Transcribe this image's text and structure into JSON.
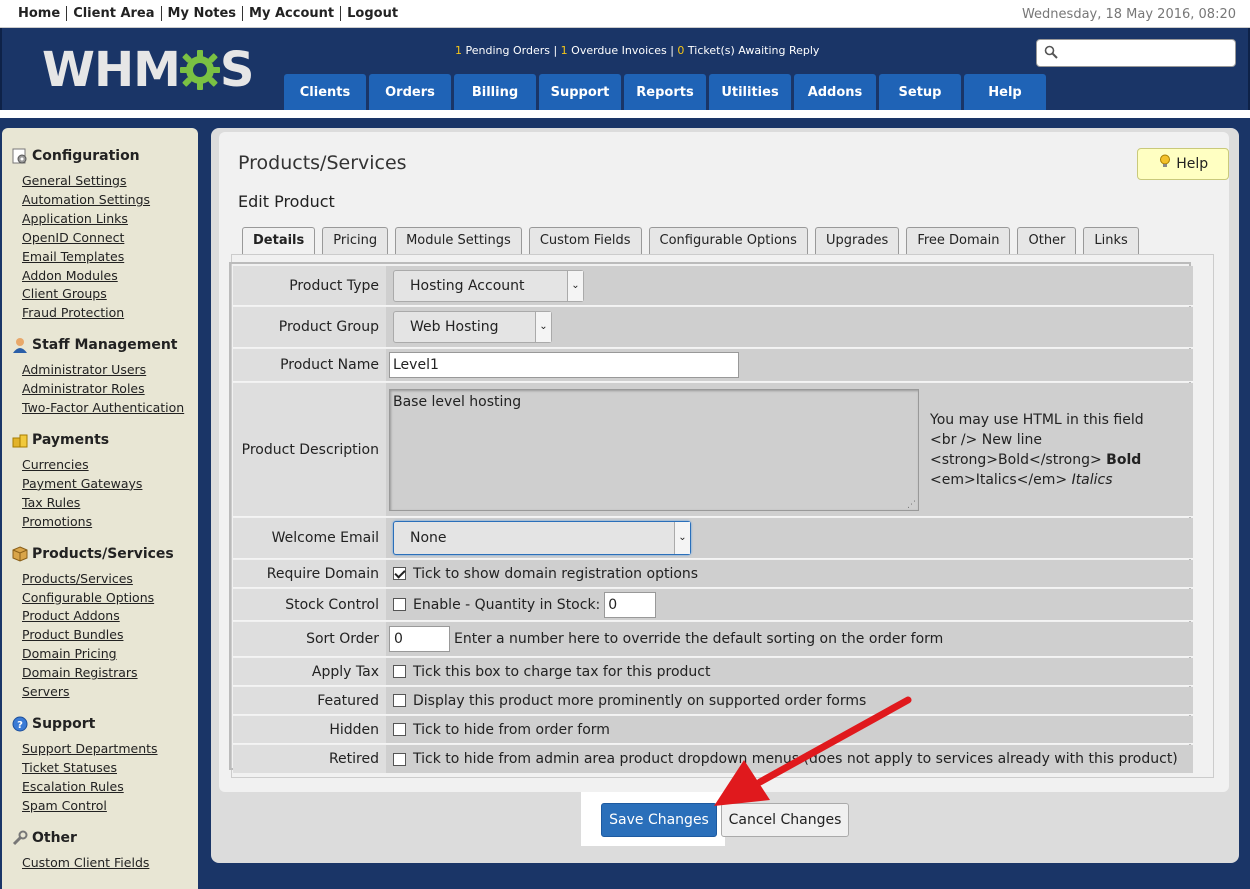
{
  "topbar": {
    "links": [
      "Home",
      "Client Area",
      "My Notes",
      "My Account",
      "Logout"
    ],
    "datetime": "Wednesday, 18 May 2016, 08:20"
  },
  "header": {
    "logo_text": "WHMCS",
    "notice": {
      "pending_orders_count": "1",
      "pending_orders_label": "Pending Orders",
      "overdue_invoices_count": "1",
      "overdue_invoices_label": "Overdue Invoices",
      "tickets_count": "0",
      "tickets_label": "Ticket(s) Awaiting Reply"
    },
    "search_placeholder": "",
    "nav": [
      "Clients",
      "Orders",
      "Billing",
      "Support",
      "Reports",
      "Utilities",
      "Addons",
      "Setup",
      "Help"
    ]
  },
  "sidebar": {
    "sections": [
      {
        "title": "Configuration",
        "icon": "gear-icon",
        "links": [
          "General Settings",
          "Automation Settings",
          "Application Links",
          "OpenID Connect",
          "Email Templates",
          "Addon Modules",
          "Client Groups",
          "Fraud Protection"
        ]
      },
      {
        "title": "Staff Management",
        "icon": "user-icon",
        "links": [
          "Administrator Users",
          "Administrator Roles",
          "Two-Factor Authentication"
        ]
      },
      {
        "title": "Payments",
        "icon": "coins-icon",
        "links": [
          "Currencies",
          "Payment Gateways",
          "Tax Rules",
          "Promotions"
        ]
      },
      {
        "title": "Products/Services",
        "icon": "box-icon",
        "links": [
          "Products/Services",
          "Configurable Options",
          "Product Addons",
          "Product Bundles",
          "Domain Pricing",
          "Domain Registrars",
          "Servers"
        ]
      },
      {
        "title": "Support",
        "icon": "help-circle-icon",
        "links": [
          "Support Departments",
          "Ticket Statuses",
          "Escalation Rules",
          "Spam Control"
        ]
      },
      {
        "title": "Other",
        "icon": "wrench-icon",
        "links": [
          "Custom Client Fields"
        ]
      }
    ]
  },
  "page": {
    "title": "Products/Services",
    "subtitle": "Edit Product",
    "help_label": "Help",
    "tabs": [
      "Details",
      "Pricing",
      "Module Settings",
      "Custom Fields",
      "Configurable Options",
      "Upgrades",
      "Free Domain",
      "Other",
      "Links"
    ],
    "active_tab": "Details"
  },
  "form": {
    "product_type": {
      "label": "Product Type",
      "value": "Hosting Account"
    },
    "product_group": {
      "label": "Product Group",
      "value": "Web Hosting"
    },
    "product_name": {
      "label": "Product Name",
      "value": "Level1"
    },
    "product_description": {
      "label": "Product Description",
      "value": "Base level hosting",
      "hint_1": "You may use HTML in this field",
      "hint_2": "<br /> New line",
      "hint_3a": "<strong>Bold</strong> ",
      "hint_3b": "Bold",
      "hint_4a": "<em>Italics</em> ",
      "hint_4b": "Italics"
    },
    "welcome_email": {
      "label": "Welcome Email",
      "value": "None"
    },
    "require_domain": {
      "label": "Require Domain",
      "text": "Tick to show domain registration options",
      "checked": true
    },
    "stock_control": {
      "label": "Stock Control",
      "text": "Enable - Quantity in Stock:",
      "checked": false,
      "quantity": "0"
    },
    "sort_order": {
      "label": "Sort Order",
      "value": "0",
      "text": "Enter a number here to override the default sorting on the order form"
    },
    "apply_tax": {
      "label": "Apply Tax",
      "text": "Tick this box to charge tax for this product",
      "checked": false
    },
    "featured": {
      "label": "Featured",
      "text": "Display this product more prominently on supported order forms",
      "checked": false
    },
    "hidden": {
      "label": "Hidden",
      "text": "Tick to hide from order form",
      "checked": false
    },
    "retired": {
      "label": "Retired",
      "text": "Tick to hide from admin area product dropdown menus (does not apply to services already with this product)",
      "checked": false
    }
  },
  "actions": {
    "save_label": "Save Changes",
    "cancel_label": "Cancel Changes"
  },
  "colors": {
    "header_bg": "#1a3567",
    "nav_tab": "#1f63b6",
    "save_button": "#2a6fba",
    "arrow": "#e0191d"
  }
}
